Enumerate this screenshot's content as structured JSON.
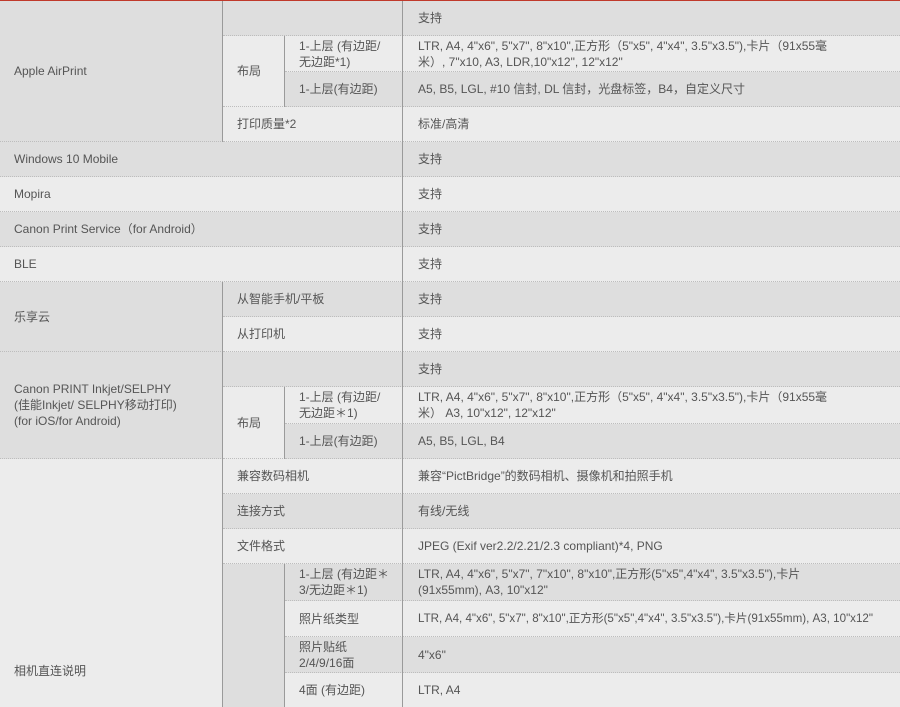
{
  "rows": {
    "airprint": {
      "label": "Apple AirPrint",
      "support_value": "支持",
      "layout_label": "布局",
      "layout_1_name": "1-上层 (有边距/无边距*1)",
      "layout_1_value": "LTR, A4, 4\"x6\", 5\"x7\", 8\"x10\",正方形（5\"x5\", 4\"x4\", 3.5\"x3.5\"),卡片（91x55毫米）, 7\"x10, A3, LDR,10\"x12\", 12\"x12\"",
      "layout_2_name": "1-上层(有边距)",
      "layout_2_value": "A5, B5, LGL, #10 信封, DL 信封，光盘标签，B4，自定义尺寸",
      "quality_label": "打印质量*2",
      "quality_value": "标准/高清"
    },
    "windows_mobile": {
      "label": "Windows 10 Mobile",
      "value": "支持"
    },
    "mopira": {
      "label": "Mopira",
      "value": "支持"
    },
    "canon_print_service": {
      "label": "Canon Print Service（for Android）",
      "value": "支持"
    },
    "ble": {
      "label": "BLE",
      "value": "支持"
    },
    "lexiangyun": {
      "label": "乐享云",
      "from_phone_label": "从智能手机/平板",
      "from_phone_value": "支持",
      "from_printer_label": "从打印机",
      "from_printer_value": "支持"
    },
    "canon_print_inkjet": {
      "label_line1": "Canon PRINT Inkjet/SELPHY",
      "label_line2": "(佳能Inkjet/ SELPHY移动打印)",
      "label_line3": "(for iOS/for Android)",
      "support_value": "支持",
      "layout_label": "布局",
      "layout_1_name": "1-上层 (有边距/无边距＊1)",
      "layout_1_value": "LTR, A4, 4\"x6\", 5\"x7\", 8\"x10\",正方形（5\"x5\", 4\"x4\", 3.5\"x3.5\"),卡片（91x55毫米） A3, 10\"x12\", 12\"x12\"",
      "layout_2_name": "1-上层(有边距)",
      "layout_2_value": "A5, B5, LGL, B4"
    },
    "camera_direct": {
      "label": "相机直连说明",
      "compat_label": "兼容数码相机",
      "compat_value": "兼容“PictBridge”的数码相机、摄像机和拍照手机",
      "connection_label": "连接方式",
      "connection_value": "有线/无线",
      "format_label": "文件格式",
      "format_value": "JPEG (Exif ver2.2/2.21/2.3 compliant)*4, PNG",
      "sub_1_name": "1-上层 (有边距＊3/无边距＊1)",
      "sub_1_value": "LTR, A4, 4\"x6\", 5\"x7\", 7\"x10\", 8\"x10\",正方形(5\"x5\",4\"x4\", 3.5\"x3.5\"),卡片(91x55mm), A3, 10\"x12\"",
      "sub_2_name": "照片纸类型",
      "sub_2_value": "LTR, A4, 4\"x6\", 5\"x7\", 8\"x10\",正方形(5\"x5\",4\"x4\", 3.5\"x3.5\"),卡片(91x55mm), A3, 10\"x12\"",
      "sub_3_name": "照片贴纸 2/4/9/16面",
      "sub_3_value": "4\"x6\"",
      "sub_4_name": "4面 (有边距)",
      "sub_4_value": "LTR, A4"
    }
  }
}
